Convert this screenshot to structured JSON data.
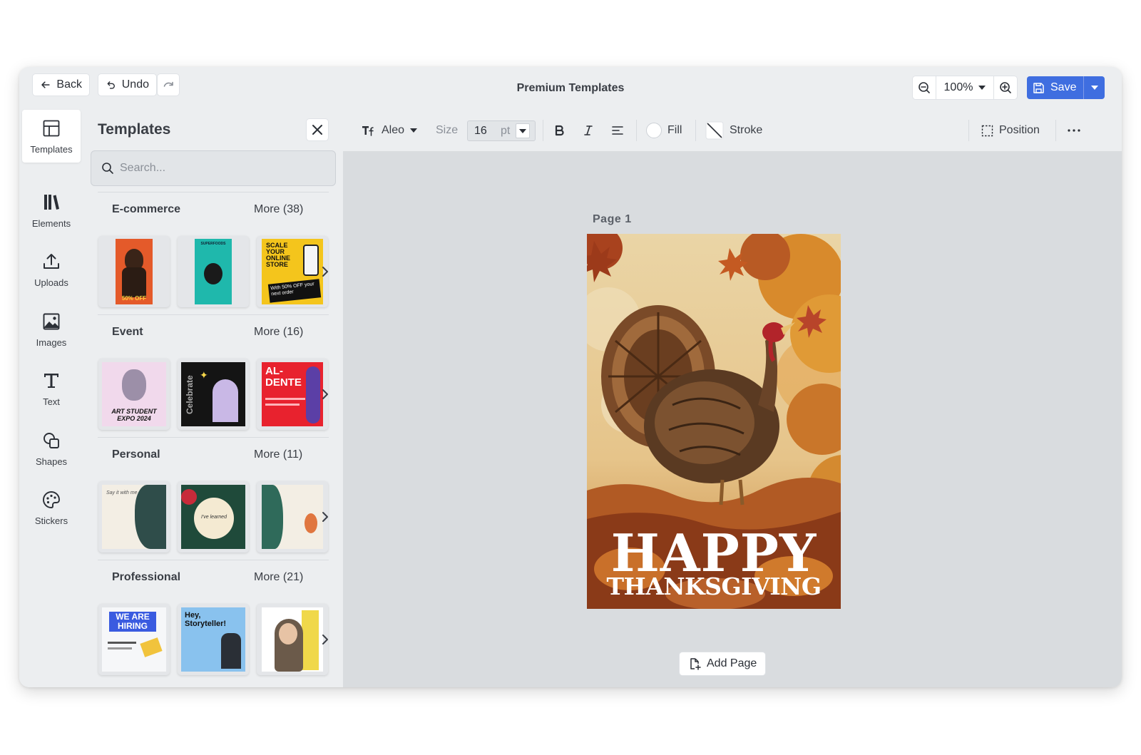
{
  "topbar": {
    "back_label": "Back",
    "undo_label": "Undo",
    "title": "Premium Templates",
    "zoom_value": "100%",
    "save_label": "Save"
  },
  "rail": {
    "items": [
      {
        "label": "Templates",
        "icon": "layout-icon"
      },
      {
        "label": "Elements",
        "icon": "library-icon"
      },
      {
        "label": "Uploads",
        "icon": "upload-icon"
      },
      {
        "label": "Images",
        "icon": "image-icon"
      },
      {
        "label": "Text",
        "icon": "text-icon"
      },
      {
        "label": "Shapes",
        "icon": "shapes-icon"
      },
      {
        "label": "Stickers",
        "icon": "sticker-icon"
      }
    ]
  },
  "panel": {
    "title": "Templates",
    "search_placeholder": "Search...",
    "sections": [
      {
        "title": "E-commerce",
        "more": "More (38)",
        "thumb_texts": [
          "50% OFF",
          "SUPERFOODS",
          "SCALE YOUR ONLINE STORE",
          "With 50% OFF your next order"
        ]
      },
      {
        "title": "Event",
        "more": "More (16)",
        "thumb_texts": [
          "ART STUDENT EXPO 2024",
          "Celebrate",
          "AL-DENTE"
        ]
      },
      {
        "title": "Personal",
        "more": "More (11)",
        "thumb_texts": [
          "Say it with me",
          "I've learned"
        ]
      },
      {
        "title": "Professional",
        "more": "More (21)",
        "thumb_texts": [
          "WE ARE HIRING",
          "Hey, Storyteller!"
        ]
      }
    ]
  },
  "toolbar": {
    "font_name": "Aleo",
    "size_label": "Size",
    "size_value": "16",
    "size_unit": "pt",
    "fill_label": "Fill",
    "stroke_label": "Stroke",
    "position_label": "Position"
  },
  "canvas": {
    "page_label": "Page  1",
    "headline_line1": "HAPPY",
    "headline_line2": "THANKSGIVING",
    "add_page_label": "Add Page"
  },
  "colors": {
    "accent": "#3f6ee0",
    "app_bg": "#eceef0",
    "canvas_bg": "#d9dcdf"
  }
}
